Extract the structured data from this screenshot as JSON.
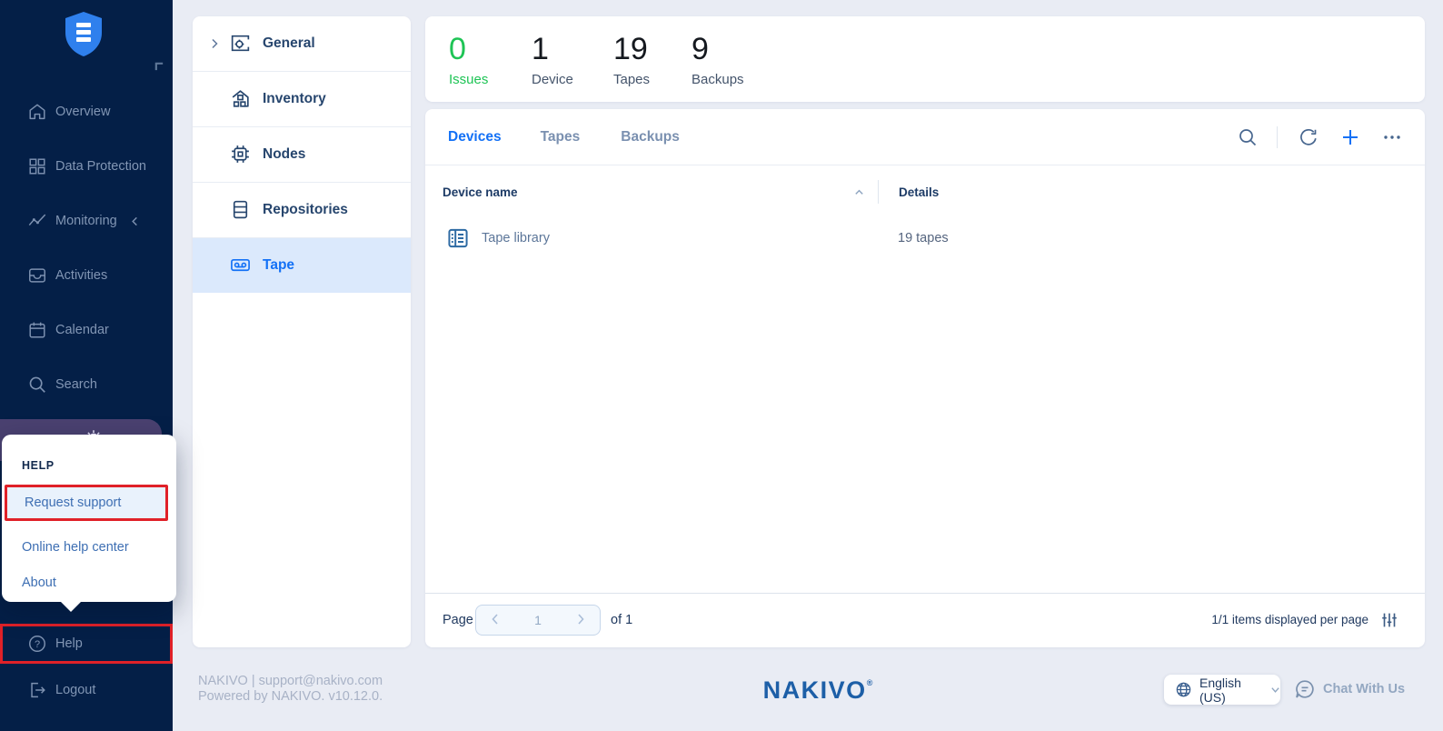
{
  "sidebar": {
    "items": [
      {
        "label": "Overview"
      },
      {
        "label": "Data Protection"
      },
      {
        "label": "Monitoring"
      },
      {
        "label": "Activities"
      },
      {
        "label": "Calendar"
      },
      {
        "label": "Search"
      }
    ],
    "help_label": "Help",
    "logout_label": "Logout"
  },
  "help_menu": {
    "title": "HELP",
    "items": [
      {
        "label": "Request support"
      },
      {
        "label": "Online help center"
      },
      {
        "label": "About"
      }
    ]
  },
  "settings_nav": {
    "items": [
      {
        "label": "General"
      },
      {
        "label": "Inventory"
      },
      {
        "label": "Nodes"
      },
      {
        "label": "Repositories"
      },
      {
        "label": "Tape"
      }
    ],
    "selected": "Tape"
  },
  "stats": [
    {
      "value": "0",
      "label": "Issues"
    },
    {
      "value": "1",
      "label": "Device"
    },
    {
      "value": "19",
      "label": "Tapes"
    },
    {
      "value": "9",
      "label": "Backups"
    }
  ],
  "tape_panel": {
    "tabs": [
      {
        "label": "Devices"
      },
      {
        "label": "Tapes"
      },
      {
        "label": "Backups"
      }
    ],
    "active_tab": "Devices",
    "table": {
      "columns": {
        "name": "Device name",
        "details": "Details"
      },
      "rows": [
        {
          "name": "Tape library",
          "details": "19 tapes"
        }
      ]
    },
    "pagination": {
      "page_label": "Page",
      "current_page": "1",
      "of_label": "of 1",
      "items_info": "1/1 items displayed per page"
    }
  },
  "footer": {
    "left_line1": "NAKIVO | support@nakivo.com",
    "left_line2": "Powered by NAKIVO. v10.12.0.",
    "logo_text": "NAKIVO",
    "logo_reg": "®",
    "language": "English (US)",
    "chat_label": "Chat With Us"
  },
  "colors": {
    "sidebar_bg": "#041f47",
    "accent_blue": "#1371f6",
    "issues_green": "#1ec455",
    "annotation_red": "#e02128",
    "selected_item_bg": "#dbe9fc",
    "settings_highlight_purple": "#4a4170",
    "page_bg": "#e9ecf4"
  }
}
